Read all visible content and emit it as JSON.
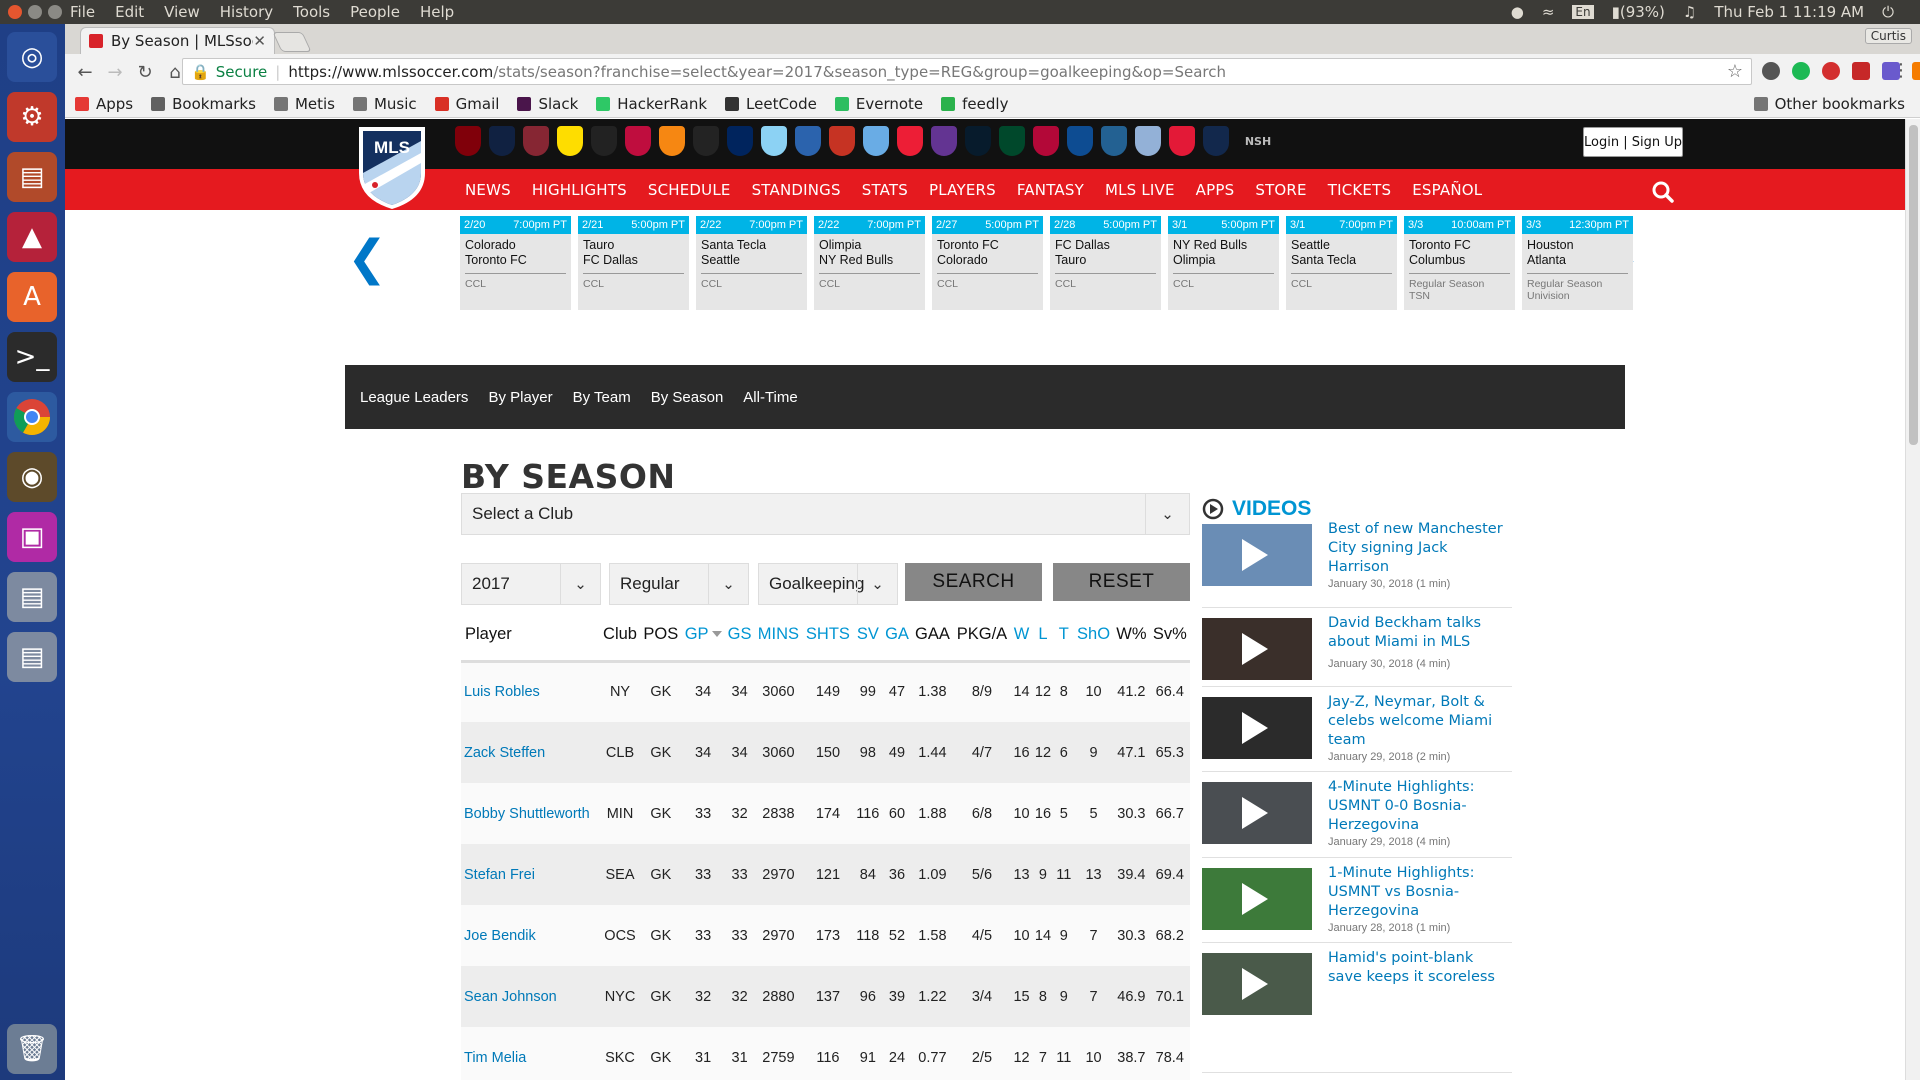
{
  "os": {
    "menu": [
      "File",
      "Edit",
      "View",
      "History",
      "Tools",
      "People",
      "Help"
    ],
    "keyboard": "En",
    "battery": "(93%)",
    "clock": "Thu Feb 1 11:19 AM",
    "user": "Curtis"
  },
  "browser": {
    "tab_title": "By Season | MLSsoc",
    "secure_label": "Secure",
    "url_host": "https://www.mlssoccer.com",
    "url_rest": "/stats/season?franchise=select&year=2017&season_type=REG&group=goalkeeping&op=Search",
    "bookmarks": [
      {
        "label": "Apps",
        "color": "#e53935"
      },
      {
        "label": "Bookmarks",
        "color": "#616161"
      },
      {
        "label": "Metis",
        "color": "#757575"
      },
      {
        "label": "Music",
        "color": "#757575"
      },
      {
        "label": "Gmail",
        "color": "#d93025"
      },
      {
        "label": "Slack",
        "color": "#4a154b"
      },
      {
        "label": "HackerRank",
        "color": "#2ec866"
      },
      {
        "label": "LeetCode",
        "color": "#333333"
      },
      {
        "label": "Evernote",
        "color": "#2dbe60"
      },
      {
        "label": "feedly",
        "color": "#2bb24c"
      }
    ],
    "other_bookmarks": "Other bookmarks"
  },
  "site": {
    "logo_text": "MLS",
    "login_label": "Login | Sign Up",
    "nav": [
      "NEWS",
      "HIGHLIGHTS",
      "SCHEDULE",
      "STANDINGS",
      "STATS",
      "PLAYERS",
      "FANTASY",
      "MLS LIVE",
      "APPS",
      "STORE",
      "TICKETS",
      "ESPAÑOL"
    ],
    "clubs": [
      {
        "abbr": "ATL",
        "color": "#80000a"
      },
      {
        "abbr": "CHI",
        "color": "#102141"
      },
      {
        "abbr": "COL",
        "color": "#862633"
      },
      {
        "abbr": "CLB",
        "color": "#fedd00"
      },
      {
        "abbr": "DC",
        "color": "#222222"
      },
      {
        "abbr": "DAL",
        "color": "#bf0d3e"
      },
      {
        "abbr": "HOU",
        "color": "#f68712"
      },
      {
        "abbr": "LAFC",
        "color": "#232323"
      },
      {
        "abbr": "LA",
        "color": "#00245d"
      },
      {
        "abbr": "MIN",
        "color": "#8cd2f4"
      },
      {
        "abbr": "MTL",
        "color": "#2b63ad"
      },
      {
        "abbr": "NE",
        "color": "#c63323"
      },
      {
        "abbr": "NYC",
        "color": "#69ace5"
      },
      {
        "abbr": "NY",
        "color": "#ed1e36"
      },
      {
        "abbr": "ORL",
        "color": "#633492"
      },
      {
        "abbr": "PHI",
        "color": "#071b2c"
      },
      {
        "abbr": "POR",
        "color": "#00482b"
      },
      {
        "abbr": "RSL",
        "color": "#b30838"
      },
      {
        "abbr": "SJ",
        "color": "#0d4c92"
      },
      {
        "abbr": "SEA",
        "color": "#236192"
      },
      {
        "abbr": "SKC",
        "color": "#93b1d7"
      },
      {
        "abbr": "TOR",
        "color": "#e31937"
      },
      {
        "abbr": "VAN",
        "color": "#12284c"
      }
    ],
    "nsh_label": "NSH"
  },
  "schedule": [
    {
      "date": "2/20",
      "time": "7:00pm PT",
      "home": "Colorado",
      "away": "Toronto FC",
      "comp": "CCL",
      "comp2": ""
    },
    {
      "date": "2/21",
      "time": "5:00pm PT",
      "home": "Tauro",
      "away": "FC Dallas",
      "comp": "CCL",
      "comp2": ""
    },
    {
      "date": "2/22",
      "time": "7:00pm PT",
      "home": "Santa Tecla",
      "away": "Seattle",
      "comp": "CCL",
      "comp2": ""
    },
    {
      "date": "2/22",
      "time": "7:00pm PT",
      "home": "Olimpia",
      "away": "NY Red Bulls",
      "comp": "CCL",
      "comp2": ""
    },
    {
      "date": "2/27",
      "time": "5:00pm PT",
      "home": "Toronto FC",
      "away": "Colorado",
      "comp": "CCL",
      "comp2": ""
    },
    {
      "date": "2/28",
      "time": "5:00pm PT",
      "home": "FC Dallas",
      "away": "Tauro",
      "comp": "CCL",
      "comp2": ""
    },
    {
      "date": "3/1",
      "time": "5:00pm PT",
      "home": "NY Red Bulls",
      "away": "Olimpia",
      "comp": "CCL",
      "comp2": ""
    },
    {
      "date": "3/1",
      "time": "7:00pm PT",
      "home": "Seattle",
      "away": "Santa Tecla",
      "comp": "CCL",
      "comp2": ""
    },
    {
      "date": "3/3",
      "time": "10:00am PT",
      "home": "Toronto FC",
      "away": "Columbus",
      "comp": "Regular Season",
      "comp2": "TSN"
    },
    {
      "date": "3/3",
      "time": "12:30pm PT",
      "home": "Houston",
      "away": "Atlanta",
      "comp": "Regular Season",
      "comp2": "Univision"
    }
  ],
  "subnav": [
    "League Leaders",
    "By Player",
    "By Team",
    "By Season",
    "All-Time"
  ],
  "page_title": "BY SEASON",
  "filters": {
    "club": "Select a Club",
    "year": "2017",
    "season_type": "Regular",
    "group": "Goalkeeping",
    "search_label": "SEARCH",
    "reset_label": "RESET"
  },
  "table": {
    "headers": [
      "Player",
      "Club",
      "POS",
      "GP",
      "GS",
      "MINS",
      "SHTS",
      "SV",
      "GA",
      "GAA",
      "PKG/A",
      "W",
      "L",
      "T",
      "ShO",
      "W%",
      "Sv%"
    ],
    "sortable": [
      false,
      false,
      false,
      true,
      true,
      true,
      true,
      true,
      true,
      false,
      false,
      true,
      true,
      true,
      true,
      false,
      false
    ],
    "rows": [
      [
        "Luis Robles",
        "NY",
        "GK",
        "34",
        "34",
        "3060",
        "149",
        "99",
        "47",
        "1.38",
        "8/9",
        "14",
        "12",
        "8",
        "10",
        "41.2",
        "66.4"
      ],
      [
        "Zack Steffen",
        "CLB",
        "GK",
        "34",
        "34",
        "3060",
        "150",
        "98",
        "49",
        "1.44",
        "4/7",
        "16",
        "12",
        "6",
        "9",
        "47.1",
        "65.3"
      ],
      [
        "Bobby Shuttleworth",
        "MIN",
        "GK",
        "33",
        "32",
        "2838",
        "174",
        "116",
        "60",
        "1.88",
        "6/8",
        "10",
        "16",
        "5",
        "5",
        "30.3",
        "66.7"
      ],
      [
        "Stefan Frei",
        "SEA",
        "GK",
        "33",
        "33",
        "2970",
        "121",
        "84",
        "36",
        "1.09",
        "5/6",
        "13",
        "9",
        "11",
        "13",
        "39.4",
        "69.4"
      ],
      [
        "Joe Bendik",
        "OCS",
        "GK",
        "33",
        "33",
        "2970",
        "173",
        "118",
        "52",
        "1.58",
        "4/5",
        "10",
        "14",
        "9",
        "7",
        "30.3",
        "68.2"
      ],
      [
        "Sean Johnson",
        "NYC",
        "GK",
        "32",
        "32",
        "2880",
        "137",
        "96",
        "39",
        "1.22",
        "3/4",
        "15",
        "8",
        "9",
        "7",
        "46.9",
        "70.1"
      ],
      [
        "Tim Melia",
        "SKC",
        "GK",
        "31",
        "31",
        "2759",
        "116",
        "91",
        "24",
        "0.77",
        "2/5",
        "12",
        "7",
        "11",
        "10",
        "38.7",
        "78.4"
      ]
    ]
  },
  "videos": {
    "heading": "VIDEOS",
    "items": [
      {
        "title": "Best of new Manchester City signing Jack Harrison",
        "date": "January 30, 2018 (1 min)",
        "thumb": "#6a8db5"
      },
      {
        "title": "David Beckham talks about Miami in MLS",
        "date": "January 30, 2018 (4 min)",
        "thumb": "#3a2f2a"
      },
      {
        "title": "Jay-Z, Neymar, Bolt & celebs welcome Miami team",
        "date": "January 29, 2018 (2 min)",
        "thumb": "#2b2b2b"
      },
      {
        "title": "4-Minute Highlights: USMNT 0-0 Bosnia-Herzegovina",
        "date": "January 29, 2018 (4 min)",
        "thumb": "#4a4e52"
      },
      {
        "title": "1-Minute Highlights: USMNT vs Bosnia-Herzegovina",
        "date": "January 28, 2018 (1 min)",
        "thumb": "#3d7a3a"
      },
      {
        "title": "Hamid's point-blank save keeps it scoreless",
        "date": "",
        "thumb": "#4a5a4a"
      }
    ]
  }
}
